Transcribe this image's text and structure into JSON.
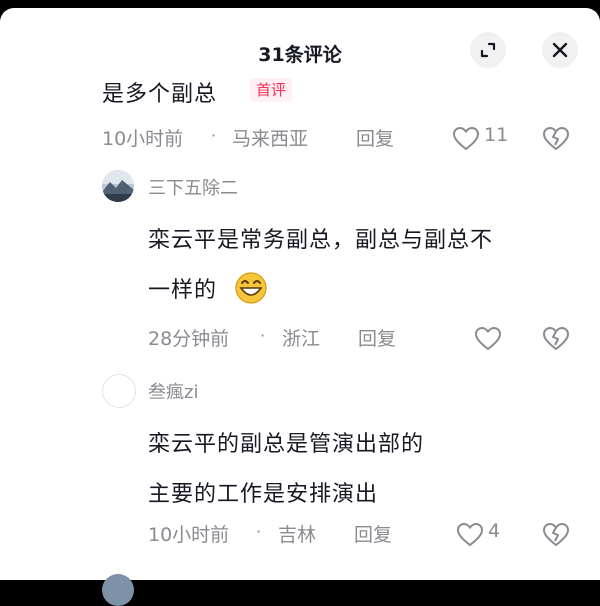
{
  "header": {
    "title": "31条评论"
  },
  "comments": [
    {
      "text": "是多个副总",
      "badge": "首评",
      "time": "10小时前",
      "location": "马来西亚",
      "reply": "回复",
      "likes": "11"
    },
    {
      "username": "三下五除二",
      "line1": "栾云平是常务副总，副总与副总不",
      "line2": "一样的",
      "time": "28分钟前",
      "location": "浙江",
      "reply": "回复",
      "likes": ""
    },
    {
      "username": "叁瘋zi",
      "line1": "栾云平的副总是管演出部的",
      "line2": "主要的工作是安排演出",
      "time": "10小时前",
      "location": "吉林",
      "reply": "回复",
      "likes": "4"
    }
  ],
  "separator": "·",
  "icons": {
    "expand": "expand-icon",
    "close": "close-icon",
    "like": "heart-outline-icon",
    "dislike": "broken-heart-icon",
    "emoji": "grinning-emoji-icon"
  },
  "colors": {
    "text": "#161823",
    "meta": "#8a8b91",
    "accent": "#fe2c55"
  }
}
